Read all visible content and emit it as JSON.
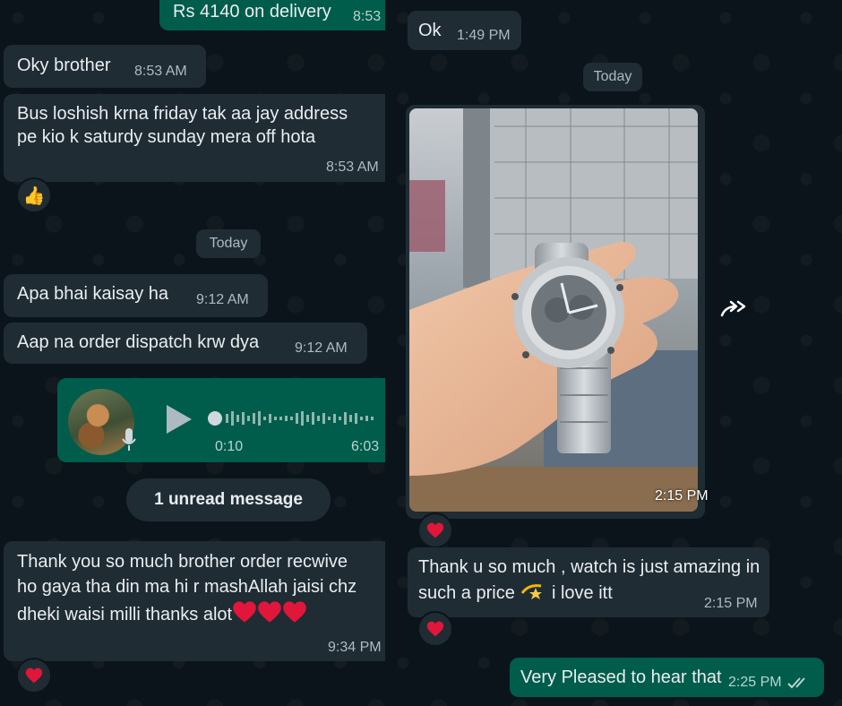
{
  "colors": {
    "background": "#0b141a",
    "incoming_bubble": "#1f2c34",
    "outgoing_bubble": "#005c4b",
    "meta_text": "#aebac1",
    "read_ticks": "#53bdeb",
    "heart": "#e0163a"
  },
  "left_chat": {
    "msg_delivery": {
      "text": "Rs 4140 on delivery",
      "time": "8:53"
    },
    "msg_oky": {
      "text": "Oky brother",
      "time": "8:53 AM"
    },
    "msg_bus": {
      "line1": "Bus loshish krna friday tak aa jay address",
      "line2": "pe kio k saturdy sunday mera off hota",
      "time": "8:53 AM"
    },
    "reaction_thumb": "👍",
    "date_chip": "Today",
    "msg_apa": {
      "text": "Apa bhai kaisay ha",
      "time": "9:12 AM"
    },
    "msg_aap": {
      "text": "Aap na order dispatch krw dya",
      "time": "9:12 AM"
    },
    "voice_note": {
      "elapsed": "0:10",
      "time": "6:03",
      "icon": "play-icon"
    },
    "unread_chip": "1 unread message",
    "msg_thank": {
      "line1": "Thank you so much brother order recwive",
      "line2": "ho gaya tha din ma hi r mashAllah jaisi chz",
      "line3": "dheki waisi milli thanks alot",
      "time": "9:34 PM"
    }
  },
  "right_chat": {
    "msg_ok": {
      "text": "Ok",
      "time": "1:49 PM"
    },
    "date_chip": "Today",
    "image_msg": {
      "time": "2:15 PM"
    },
    "forward_icon": "forward-icon",
    "msg_thanku": {
      "line1": "Thank u so much , watch is just amazing in",
      "line2": "such a price",
      "line2b": "i love itt",
      "time": "2:15 PM"
    },
    "msg_pleased": {
      "text": "Very Pleased to hear that",
      "time": "2:25 PM"
    }
  }
}
